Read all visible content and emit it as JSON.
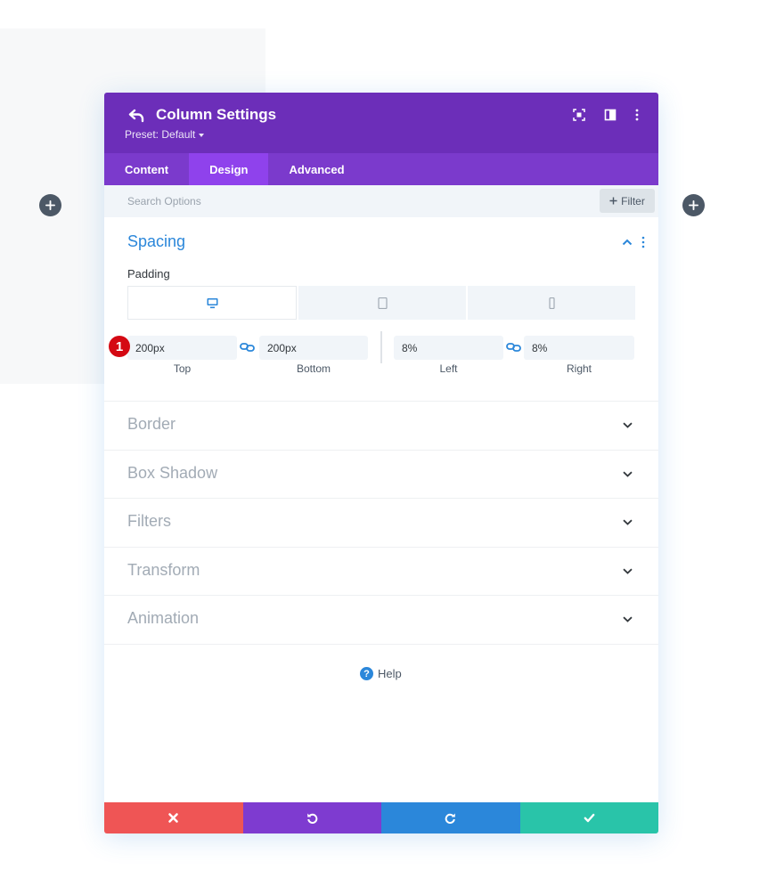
{
  "modal": {
    "title": "Column Settings",
    "preset": "Preset: Default"
  },
  "tabs": [
    {
      "label": "Content",
      "active": false
    },
    {
      "label": "Design",
      "active": true
    },
    {
      "label": "Advanced",
      "active": false
    }
  ],
  "search": {
    "placeholder": "Search Options",
    "filter_label": "Filter"
  },
  "spacing": {
    "title": "Spacing",
    "padding_label": "Padding",
    "devices": [
      "desktop-icon",
      "tablet-icon",
      "phone-icon"
    ],
    "active_device": "desktop",
    "fields": {
      "top": {
        "value": "200px",
        "label": "Top"
      },
      "bottom": {
        "value": "200px",
        "label": "Bottom"
      },
      "left": {
        "value": "8%",
        "label": "Left"
      },
      "right": {
        "value": "8%",
        "label": "Right"
      }
    },
    "step_badge": "1"
  },
  "sections": [
    {
      "title": "Border"
    },
    {
      "title": "Box Shadow"
    },
    {
      "title": "Filters"
    },
    {
      "title": "Transform"
    },
    {
      "title": "Animation"
    }
  ],
  "help": {
    "label": "Help",
    "icon": "?"
  },
  "footer": {
    "buttons": [
      "cancel",
      "undo",
      "redo",
      "save"
    ]
  },
  "colors": {
    "header": "#6c2eb9",
    "tabs": "#7b3acc",
    "tab_active": "#8f42ec",
    "accent": "#2b87da",
    "cancel": "#ef5555",
    "undo": "#7e3bd0",
    "redo": "#2b87da",
    "save": "#29c4a9",
    "badge": "#d40913"
  }
}
